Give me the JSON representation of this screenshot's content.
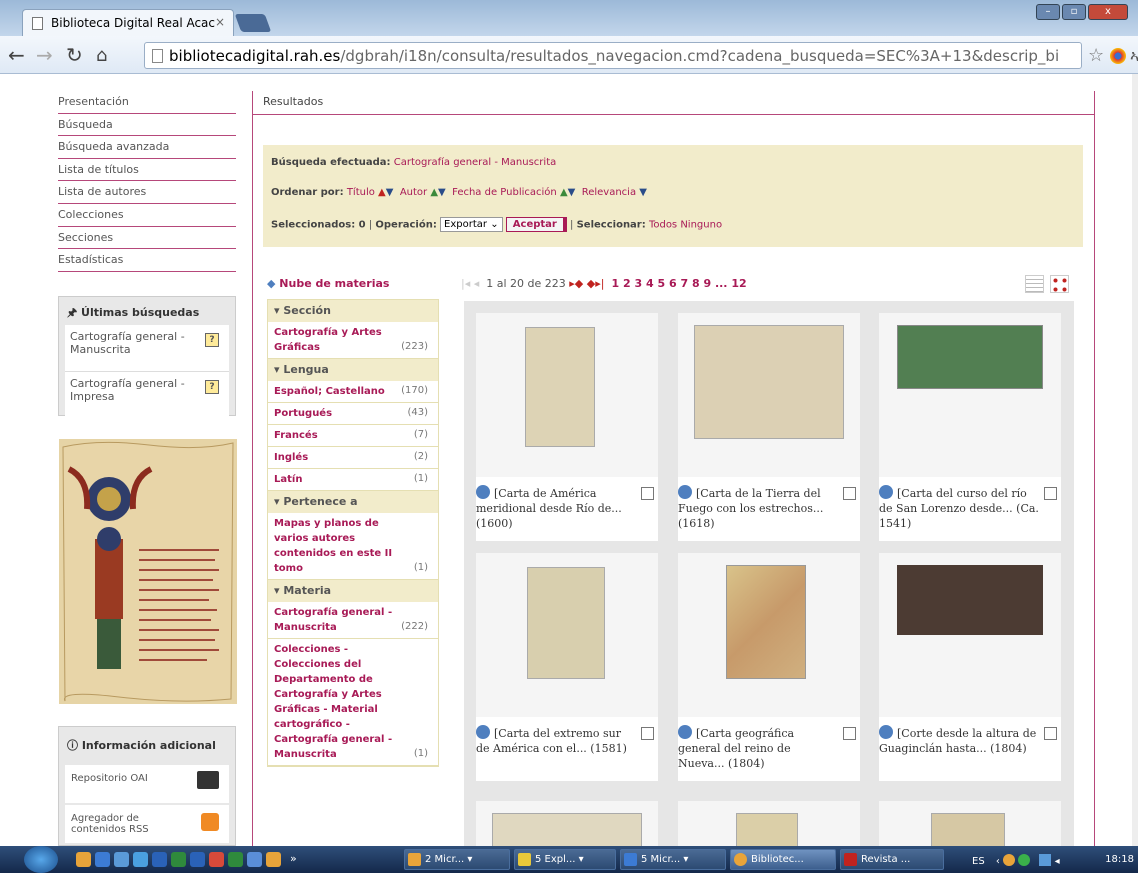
{
  "browser": {
    "tab_title": "Biblioteca Digital Real Acac",
    "tab_close": "×",
    "url_domain": "bibliotecadigital.rah.es",
    "url_path": "/dgbrah/i18n/consulta/resultados_navegacion.cmd?cadena_busqueda=SEC%3A+13&descrip_bi"
  },
  "sidebar": {
    "nav": [
      "Presentación",
      "Búsqueda",
      "Búsqueda avanzada",
      "Lista de títulos",
      "Lista de autores",
      "Colecciones",
      "Secciones",
      "Estadísticas"
    ],
    "ultimas_title": "Últimas búsquedas",
    "ultimas": [
      "Cartografía general - Manuscrita",
      "Cartografía general - Impresa"
    ],
    "info_title": "Información adicional",
    "info_items": [
      "Repositorio OAI",
      "Agregador de contenidos RSS"
    ]
  },
  "main": {
    "header": "Resultados",
    "busqueda_label": "Búsqueda efectuada:",
    "busqueda_value": "Cartografía general - Manuscrita",
    "ordenar_label": "Ordenar por:",
    "ordenar": [
      "Título",
      "Autor",
      "Fecha de Publicación",
      "Relevancia"
    ],
    "seleccionados_label": "Seleccionados: 0",
    "operacion_label": "Operación:",
    "operacion_value": "Exportar",
    "aceptar": "Aceptar",
    "seleccionar_label": "Seleccionar:",
    "todos": "Todos",
    "ninguno": "Ninguno",
    "nube": "Nube de materias",
    "pager_range": "1 al 20 de 223",
    "pages": [
      "1",
      "2",
      "3",
      "4",
      "5",
      "6",
      "7",
      "8",
      "9",
      "... 12"
    ]
  },
  "facets": [
    {
      "title": "Sección",
      "items": [
        {
          "label": "Cartografía y Artes Gráficas",
          "count": "(223)"
        }
      ]
    },
    {
      "title": "Lengua",
      "items": [
        {
          "label": "Español; Castellano",
          "count": "(170)"
        },
        {
          "label": "Portugués",
          "count": "(43)"
        },
        {
          "label": "Francés",
          "count": "(7)"
        },
        {
          "label": "Inglés",
          "count": "(2)"
        },
        {
          "label": "Latín",
          "count": "(1)"
        }
      ]
    },
    {
      "title": "Pertenece a",
      "items": [
        {
          "label": "Mapas y planos de varios autores contenidos en este II tomo",
          "count": "(1)"
        }
      ]
    },
    {
      "title": "Materia",
      "items": [
        {
          "label": "Cartografía general - Manuscrita",
          "count": "(222)"
        },
        {
          "label": "Colecciones - Colecciones del Departamento de Cartografía y Artes Gráficas - Material cartográfico - Cartografía general - Manuscrita",
          "count": "(1)"
        }
      ]
    }
  ],
  "results": [
    {
      "title": "[Carta de América meridional desde Río de... (1600)",
      "color": "#d8cfae"
    },
    {
      "title": "[Carta de la Tierra del Fuego con los estrechos... (1618)",
      "color": "#d9ccb0"
    },
    {
      "title": "[Carta del curso del río de San Lorenzo desde... (Ca. 1541)",
      "color": "#4e7a4e"
    },
    {
      "title": "[Carta del extremo sur de América con el... (1581)",
      "color": "#d6cca8"
    },
    {
      "title": "[Carta geográfica general del reino de Nueva... (1804)",
      "color": "#c9a86a"
    },
    {
      "title": "[Corte desde la altura de Guaginclán hasta... (1804)",
      "color": "#4a3a32"
    }
  ],
  "taskbar": {
    "items": [
      "2 Micr...",
      "5 Expl...",
      "5 Micr...",
      "Bibliotec...",
      "Revista ..."
    ],
    "lang": "ES",
    "clock": "18:18"
  },
  "colors": {
    "accent": "#a81a56",
    "search_bg": "#f2eccb",
    "chrome": "#c9dcef"
  }
}
